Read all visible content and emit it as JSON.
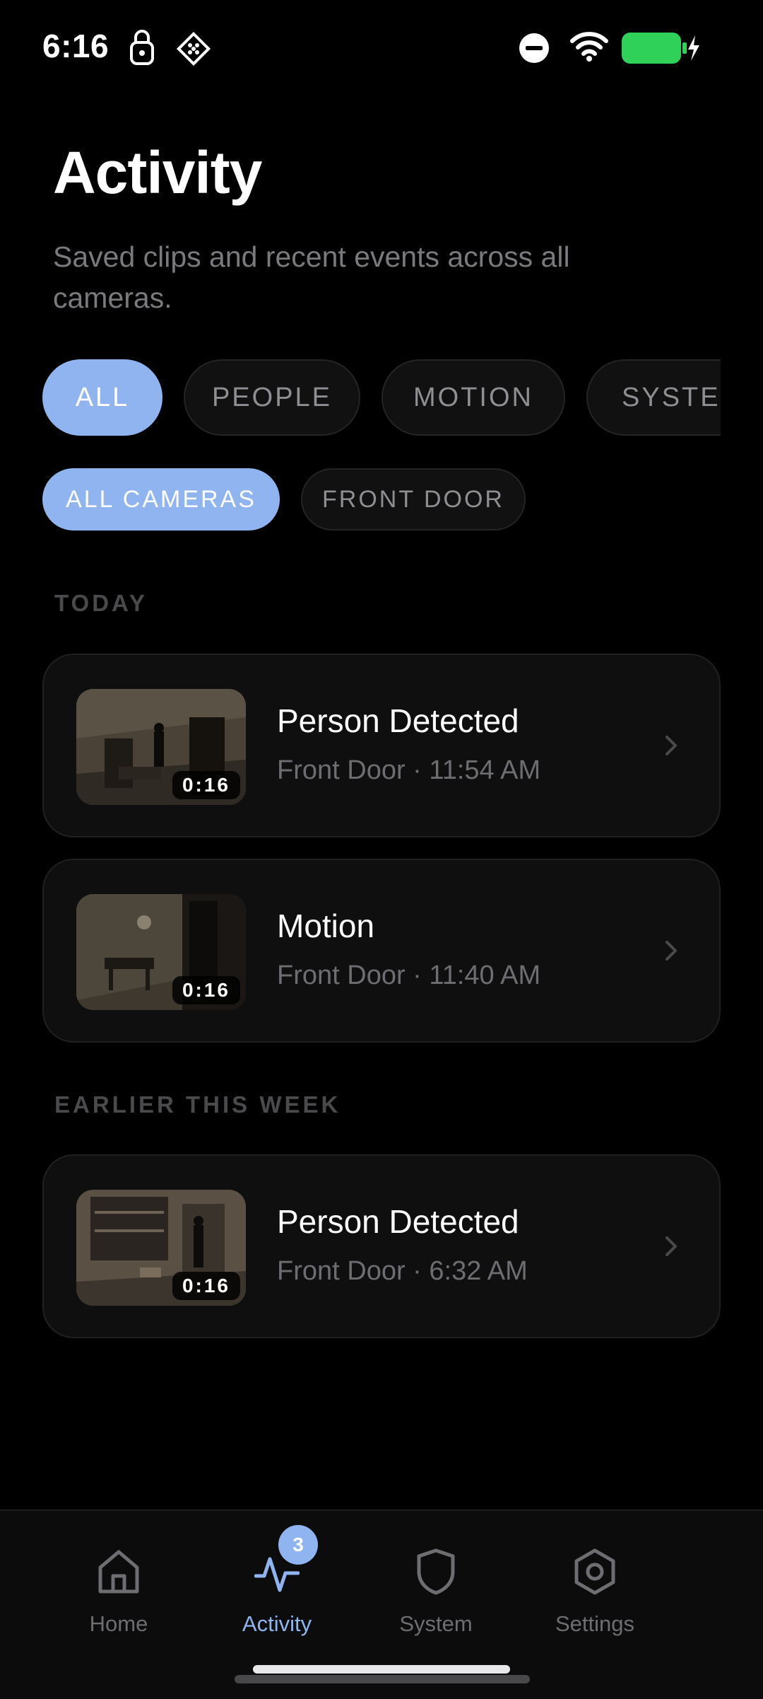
{
  "status_bar": {
    "time": "6:16"
  },
  "header": {
    "title": "Activity",
    "subtitle": "Saved clips and recent events across all cameras."
  },
  "filters": {
    "event_types": [
      {
        "label": "ALL",
        "active": true
      },
      {
        "label": "PEOPLE",
        "active": false
      },
      {
        "label": "MOTION",
        "active": false
      },
      {
        "label": "SYSTEM",
        "active": false
      }
    ],
    "cameras": [
      {
        "label": "ALL CAMERAS",
        "active": true
      },
      {
        "label": "FRONT DOOR",
        "active": false
      }
    ]
  },
  "sections": {
    "today": {
      "label": "TODAY",
      "events": [
        {
          "title": "Person Detected",
          "meta": "Front Door · 11:54 AM",
          "duration": "0:16"
        },
        {
          "title": "Motion",
          "meta": "Front Door · 11:40 AM",
          "duration": "0:16"
        }
      ]
    },
    "earlier": {
      "label": "EARLIER THIS WEEK",
      "events": [
        {
          "title": "Person Detected",
          "meta": "Front Door · 6:32 AM",
          "duration": "0:16"
        }
      ]
    }
  },
  "bottom_nav": {
    "items": [
      {
        "label": "Home",
        "icon": "home-icon",
        "active": false
      },
      {
        "label": "Activity",
        "icon": "activity-icon",
        "active": true,
        "badge": "3"
      },
      {
        "label": "System",
        "icon": "shield-icon",
        "active": false
      },
      {
        "label": "Settings",
        "icon": "gear-icon",
        "active": false
      }
    ]
  },
  "colors": {
    "background": "#000000",
    "accent": "#8fb4ef",
    "card": "#0f0f10",
    "muted_text": "#6d6d72",
    "battery": "#30d158"
  }
}
